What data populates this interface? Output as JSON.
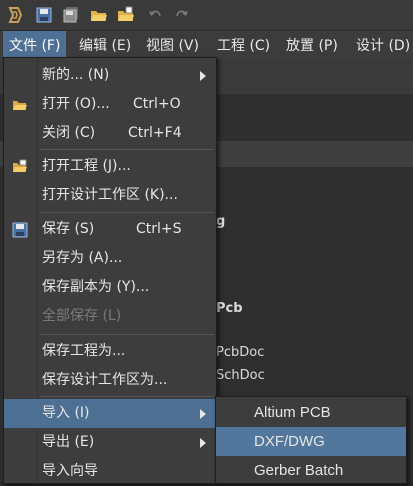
{
  "toolbar": {
    "icons": [
      "app-logo-icon",
      "save-icon",
      "save-all-icon",
      "open-folder-icon",
      "open-project-icon",
      "undo-icon",
      "redo-icon"
    ]
  },
  "menubar": {
    "items": [
      {
        "label": "文件 (F)",
        "active": true
      },
      {
        "label": "编辑 (E)"
      },
      {
        "label": "视图 (V)"
      },
      {
        "label": "工程 (C)"
      },
      {
        "label": "放置 (P)"
      },
      {
        "label": "设计 (D)"
      }
    ]
  },
  "background": {
    "texts": [
      "g",
      "Pcb",
      "PcbDoc",
      "SchDoc"
    ]
  },
  "file_menu": {
    "items": [
      {
        "label": "新的... (N)",
        "shortcut": "",
        "submenu": true
      },
      {
        "label": "打开 (O)...",
        "shortcut": "Ctrl+O",
        "icon": "open-folder-icon"
      },
      {
        "label": "关闭 (C)",
        "shortcut": "Ctrl+F4"
      },
      {
        "label": "打开工程 (J)...",
        "shortcut": "",
        "icon": "open-project-icon"
      },
      {
        "label": "打开设计工作区 (K)...",
        "shortcut": ""
      },
      {
        "label": "保存 (S)",
        "shortcut": "Ctrl+S",
        "icon": "save-icon"
      },
      {
        "label": "另存为 (A)...",
        "shortcut": ""
      },
      {
        "label": "保存副本为 (Y)...",
        "shortcut": ""
      },
      {
        "label": "全部保存 (L)",
        "shortcut": "",
        "disabled": true
      },
      {
        "label": "保存工程为...",
        "shortcut": ""
      },
      {
        "label": "保存设计工作区为...",
        "shortcut": ""
      },
      {
        "label": "导入 (I)",
        "shortcut": "",
        "submenu": true,
        "highlight": true
      },
      {
        "label": "导出 (E)",
        "shortcut": "",
        "submenu": true
      },
      {
        "label": "导入向导",
        "shortcut": ""
      }
    ]
  },
  "import_submenu": {
    "items": [
      {
        "label": "Altium PCB"
      },
      {
        "label": "DXF/DWG",
        "highlight": true
      },
      {
        "label": "Gerber Batch"
      }
    ]
  },
  "colors": {
    "accent": "#4f7095",
    "highlight": "#52769c",
    "menu_bg": "#3d3d3d"
  }
}
